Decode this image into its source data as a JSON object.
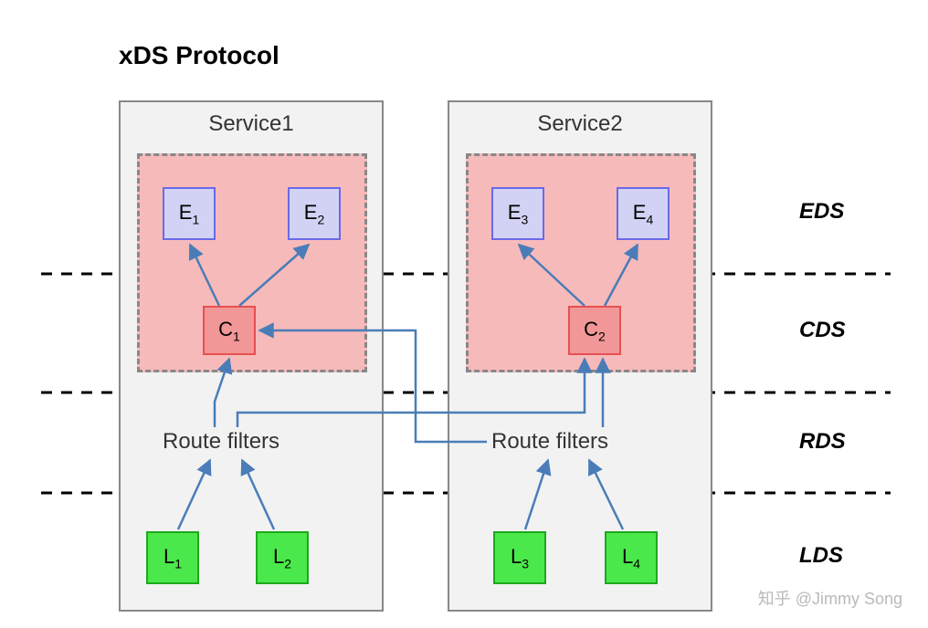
{
  "title": "xDS Protocol",
  "services": [
    {
      "name": "Service1",
      "route": "Route filters"
    },
    {
      "name": "Service2",
      "route": "Route filters"
    }
  ],
  "layers": {
    "eds": "EDS",
    "cds": "CDS",
    "rds": "RDS",
    "lds": "LDS"
  },
  "nodes": {
    "e1": "E",
    "e1s": "1",
    "e2": "E",
    "e2s": "2",
    "e3": "E",
    "e3s": "3",
    "e4": "E",
    "e4s": "4",
    "c1": "C",
    "c1s": "1",
    "c2": "C",
    "c2s": "2",
    "l1": "L",
    "l1s": "1",
    "l2": "L",
    "l2s": "2",
    "l3": "L",
    "l3s": "3",
    "l4": "L",
    "l4s": "4"
  },
  "watermark": "知乎 @Jimmy Song"
}
